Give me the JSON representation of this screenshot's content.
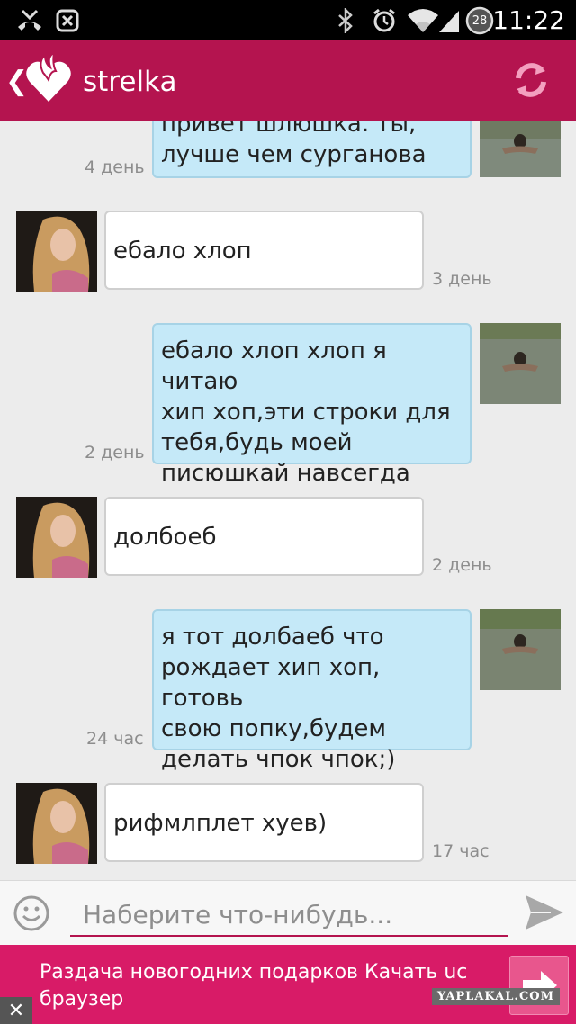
{
  "status_bar": {
    "time": "11:22",
    "battery_level": "28",
    "icons": [
      "missed-call-icon",
      "screenshot-icon",
      "bluetooth-icon",
      "alarm-icon",
      "wifi-icon",
      "signal-icon",
      "battery-icon"
    ]
  },
  "app_bar": {
    "title": "strelka",
    "back_glyph": "❮",
    "brand_color": "#b4144f"
  },
  "messages": [
    {
      "direction": "out",
      "text_lines": [
        "привет шлюшка. ты,",
        "лучше чем сурганова"
      ],
      "time": "4 день"
    },
    {
      "direction": "in",
      "text_lines": [
        "ебало хлоп"
      ],
      "time": "3 день"
    },
    {
      "direction": "out",
      "text_lines": [
        "ебало хлоп хлоп я читаю",
        "хип хоп,эти строки для",
        "тебя,будь моей",
        "писюшкай навсегда"
      ],
      "time": "2 день"
    },
    {
      "direction": "in",
      "text_lines": [
        "долбоеб"
      ],
      "time": "2 день"
    },
    {
      "direction": "out",
      "text_lines": [
        "я тот долбаеб что",
        "рождает хип хоп, готовь",
        "свою попку,будем",
        "делать чпок чпок;)"
      ],
      "time": "24 час"
    },
    {
      "direction": "in",
      "text_lines": [
        "рифмлплет хуев)"
      ],
      "time": "17 час"
    }
  ],
  "composer": {
    "placeholder": "Наберите что-нибудь..."
  },
  "ad": {
    "text": "Раздача новогодних подарков Качать uc браузер",
    "close_glyph": "✕",
    "watermark": "YAPLAKAL.COM",
    "color": "#d81b67"
  }
}
